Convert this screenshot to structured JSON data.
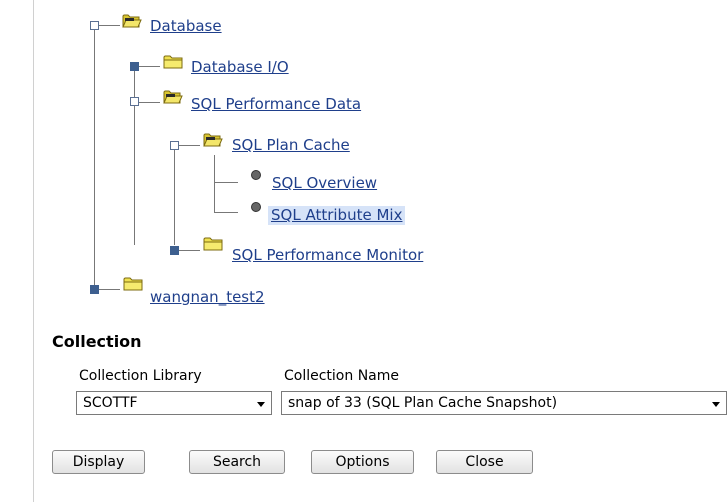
{
  "tree": {
    "items": [
      {
        "label": "Database",
        "state": "expanded",
        "icon": "open-folder-icon"
      },
      {
        "label": "Database I/O",
        "state": "collapsed",
        "icon": "folder-icon"
      },
      {
        "label": "SQL Performance Data",
        "state": "expanded",
        "icon": "open-folder-icon"
      },
      {
        "label": "SQL Plan Cache",
        "state": "expanded",
        "icon": "open-folder-icon"
      },
      {
        "label": "SQL Overview",
        "state": "leaf",
        "icon": "leaf-bullet-icon"
      },
      {
        "label": "SQL Attribute Mix",
        "state": "leaf",
        "icon": "leaf-bullet-icon",
        "selected": true
      },
      {
        "label": "SQL Performance Monitor",
        "state": "collapsed",
        "icon": "folder-icon"
      },
      {
        "label": "wangnan_test2",
        "state": "collapsed",
        "icon": "folder-icon"
      }
    ]
  },
  "collection": {
    "title": "Collection",
    "library_label": "Collection Library",
    "library_value": "SCOTTF",
    "name_label": "Collection Name",
    "name_value": "snap of 33 (SQL Plan Cache Snapshot)"
  },
  "buttons": {
    "display": "Display",
    "search": "Search",
    "options": "Options",
    "close": "Close"
  },
  "colors": {
    "link": "#1f3f8b",
    "selected_bg": "#d6e3f8",
    "expander_fill": "#3d5f8f",
    "folder": "#e8d840"
  }
}
